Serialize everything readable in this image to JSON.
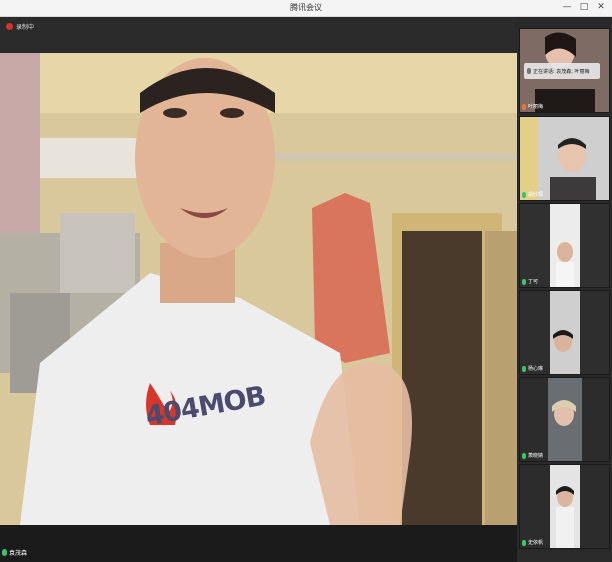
{
  "window": {
    "title": "腾讯会议",
    "controls": {
      "minimize": "—",
      "maximize": "□",
      "close": "✕"
    }
  },
  "recording": {
    "label": "录制中"
  },
  "main_speaker": {
    "name": "袁茂森"
  },
  "tooltip": {
    "text": "正在讲话: 袁茂森; 叶丽梅"
  },
  "participants": [
    {
      "name": "叶丽梅"
    },
    {
      "name": "胡欣桐"
    },
    {
      "name": "丁可"
    },
    {
      "name": "杨心琳"
    },
    {
      "name": "萧晓婧"
    },
    {
      "name": "史依帆"
    }
  ],
  "shirt_print": "404MOB",
  "colors": {
    "mic_on": "#3cc36b",
    "recording": "#d8322b"
  }
}
